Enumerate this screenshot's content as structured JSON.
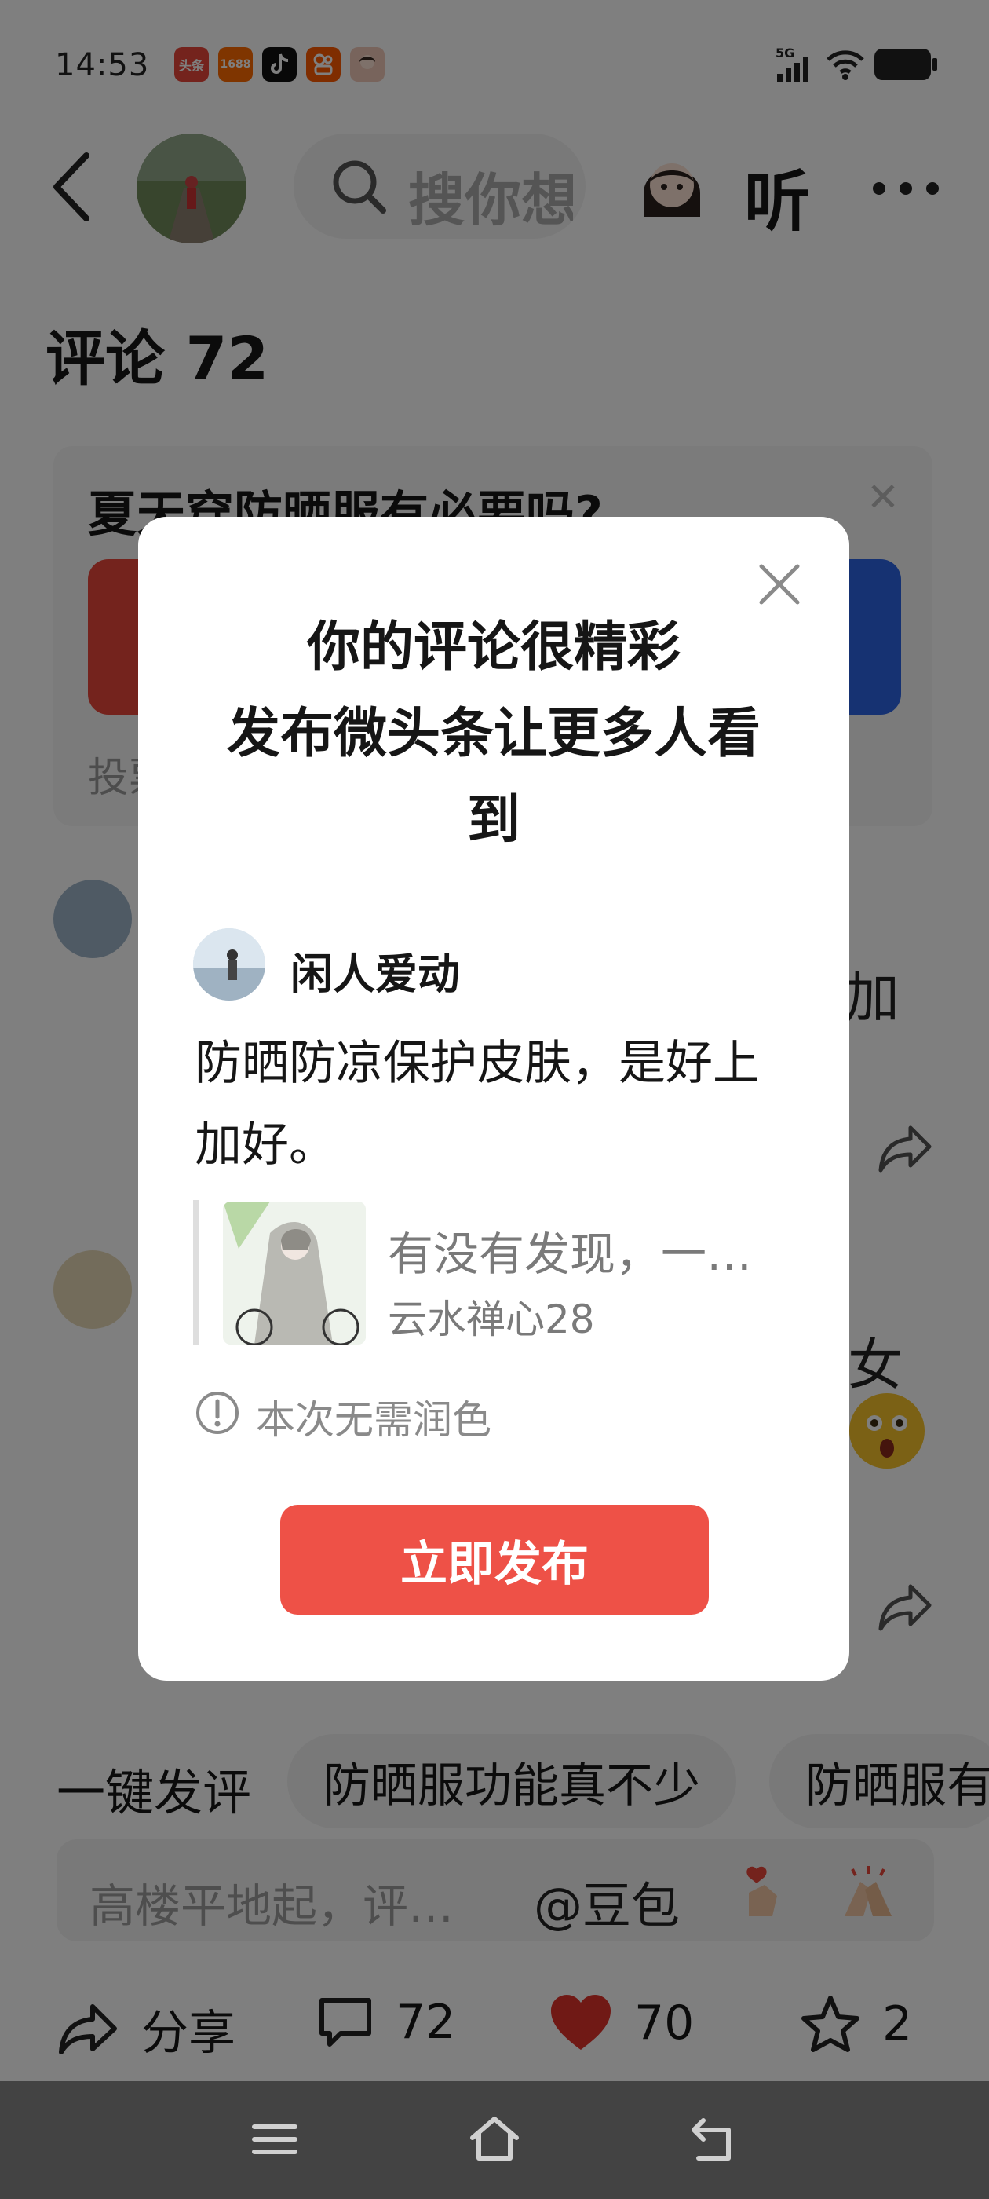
{
  "status_bar": {
    "time": "14:53",
    "app_icons": [
      {
        "name": "toutiao",
        "label": "头条",
        "color": "#e8473a"
      },
      {
        "name": "1688",
        "label": "1688",
        "color": "#ff6a00"
      },
      {
        "name": "douyin",
        "label": "",
        "color": "#111111"
      },
      {
        "name": "kuaishou",
        "label": "",
        "color": "#ff5a00"
      },
      {
        "name": "avatar",
        "label": "",
        "color": "#f0c8b8"
      }
    ],
    "network": "5G"
  },
  "header": {
    "search_placeholder": "搜你想",
    "listen_label": "听"
  },
  "comments_title": "评论 72",
  "poll": {
    "question": "夏天穿防晒服有必要吗?",
    "vote_hint": "投票"
  },
  "background_comments": [
    {
      "tail": "加"
    },
    {
      "tail": "女"
    }
  ],
  "quick_comment": {
    "label": "一键发评",
    "chips": [
      "防晒服功能真不少",
      "防晒服有"
    ]
  },
  "input_bar": {
    "placeholder": "高楼平地起，评…",
    "mention": "@豆包"
  },
  "action_bar": {
    "share": "分享",
    "comments": "72",
    "likes": "70",
    "favorites": "2"
  },
  "modal": {
    "title_line1": "你的评论很精彩",
    "title_line2": "发布微头条让更多人看",
    "title_line3": "到",
    "username": "闲人爱动",
    "comment_text": "防晒防凉保护皮肤，是好上加好。",
    "quote_text": "有没有发现，一…",
    "quote_author": "云水禅心28",
    "note": "本次无需润色",
    "publish_label": "立即发布"
  },
  "colors": {
    "publish": "#ee5147",
    "poll_red": "#e8473a",
    "poll_blue": "#2d64e4",
    "like_red": "#e0322b"
  }
}
